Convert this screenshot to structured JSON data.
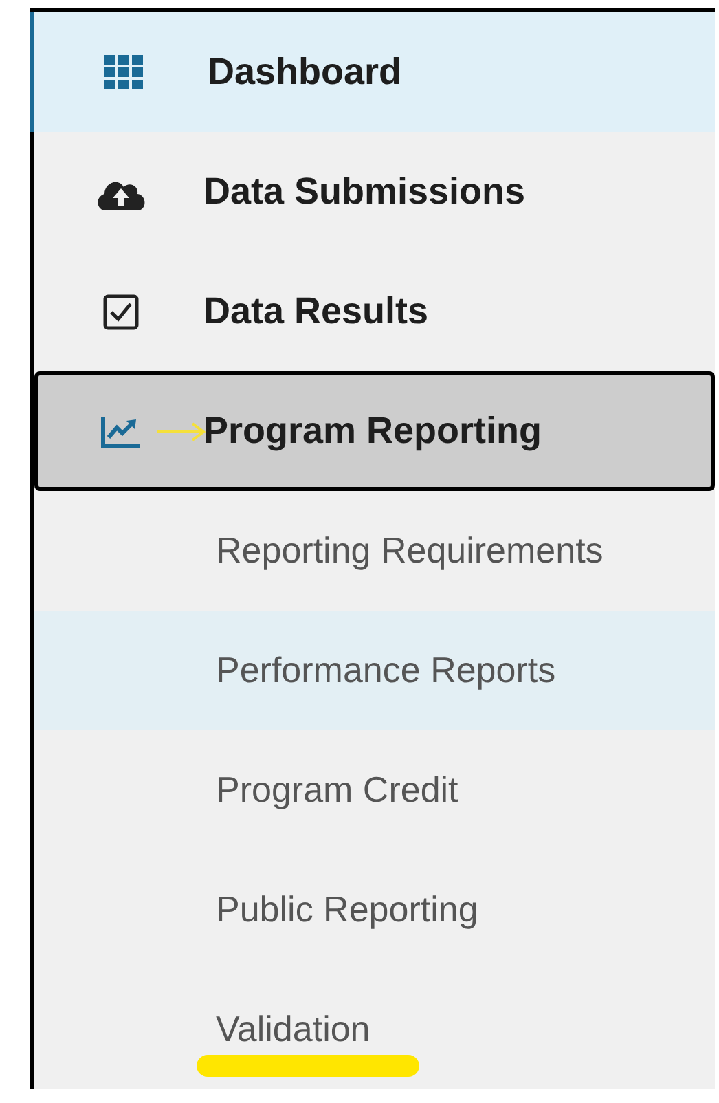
{
  "nav": {
    "items": [
      {
        "label": "Dashboard",
        "kind": "grid",
        "selected": true,
        "expanded": false
      },
      {
        "label": "Data Submissions",
        "kind": "cloud-upload",
        "selected": false,
        "expanded": false
      },
      {
        "label": "Data Results",
        "kind": "checkbox",
        "selected": false,
        "expanded": false
      },
      {
        "label": "Program Reporting",
        "kind": "chart",
        "selected": false,
        "expanded": true,
        "children": [
          {
            "label": "Reporting Requirements",
            "highlighted": false
          },
          {
            "label": "Performance Reports",
            "highlighted": true
          },
          {
            "label": "Program Credit",
            "highlighted": false
          },
          {
            "label": "Public Reporting",
            "highlighted": false
          },
          {
            "label": "Validation",
            "highlighted": false
          }
        ]
      }
    ]
  }
}
